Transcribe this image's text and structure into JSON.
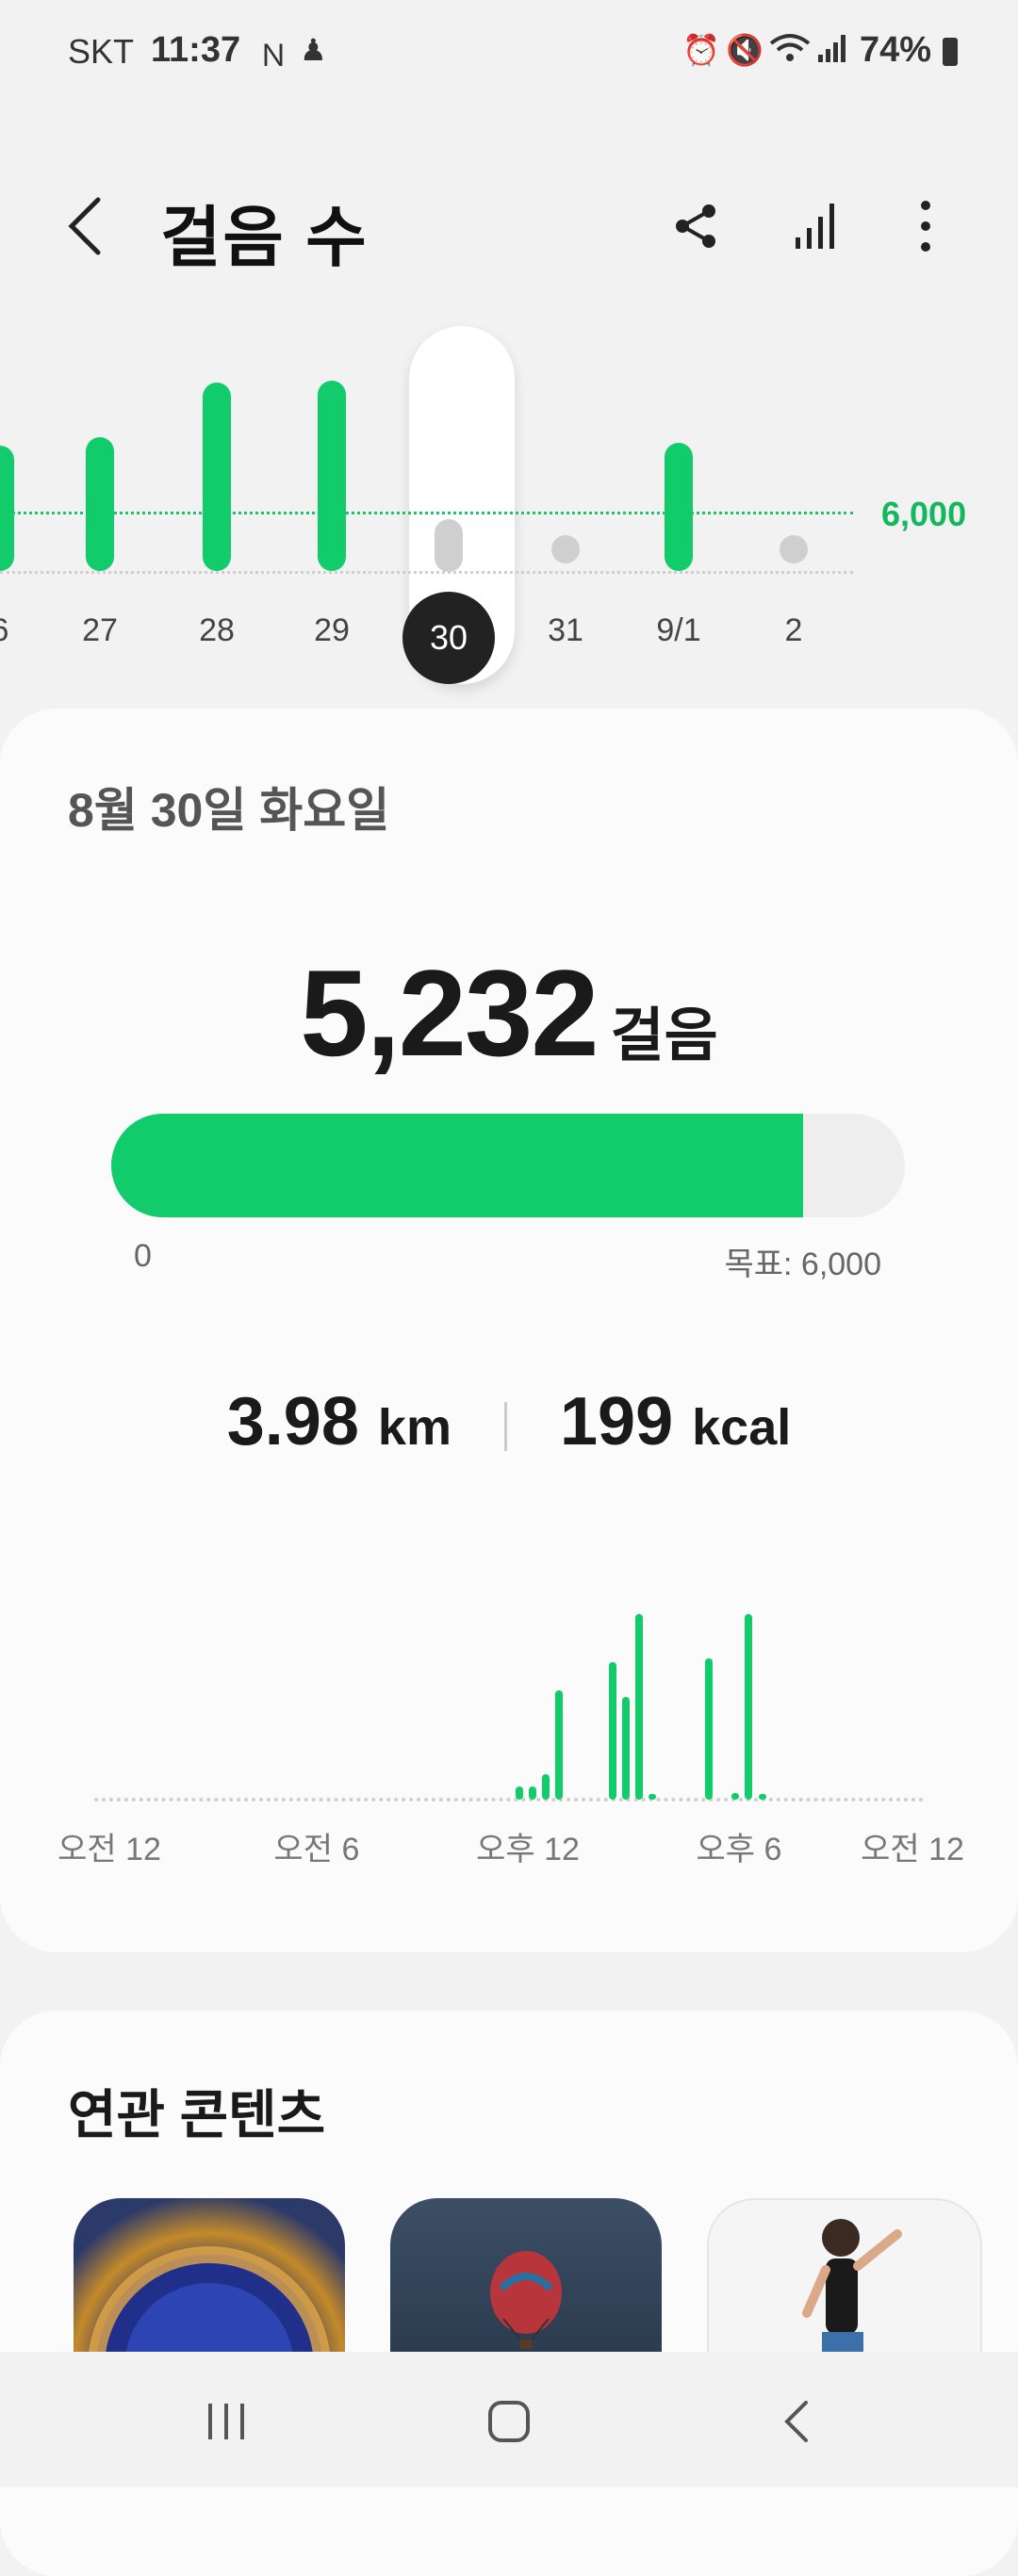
{
  "status_bar": {
    "carrier": "SKT",
    "time": "11:37",
    "battery": "74%"
  },
  "header": {
    "title": "걸음 수"
  },
  "week_chart": {
    "goal_label": "6,000",
    "days": [
      {
        "label": "6",
        "steps": 6000
      },
      {
        "label": "27",
        "steps": 6400
      },
      {
        "label": "28",
        "steps": 9000
      },
      {
        "label": "29",
        "steps": 9100
      },
      {
        "label": "30",
        "steps": 5232,
        "selected": true
      },
      {
        "label": "31",
        "steps": 0
      },
      {
        "label": "9/1",
        "steps": 6100
      },
      {
        "label": "2",
        "steps": 0
      }
    ]
  },
  "summary": {
    "date": "8월 30일 화요일",
    "steps": "5,232",
    "steps_unit": "걸음",
    "progress_fraction": 0.872,
    "progress_min": "0",
    "progress_goal": "목표: 6,000",
    "distance": "3.98",
    "distance_unit": "km",
    "calories": "199",
    "calories_unit": "kcal"
  },
  "chart_data": {
    "type": "bar",
    "x_labels": [
      "오전 12",
      "오전 6",
      "오후 12",
      "오후 6",
      "오전 12"
    ],
    "series": [
      {
        "hour": 12.3,
        "value": 8
      },
      {
        "hour": 12.7,
        "value": 8
      },
      {
        "hour": 13.1,
        "value": 16
      },
      {
        "hour": 13.5,
        "value": 68
      },
      {
        "hour": 15.1,
        "value": 86
      },
      {
        "hour": 15.5,
        "value": 64
      },
      {
        "hour": 15.9,
        "value": 116
      },
      {
        "hour": 16.3,
        "value": 3
      },
      {
        "hour": 18.0,
        "value": 88
      },
      {
        "hour": 18.8,
        "value": 4
      },
      {
        "hour": 19.2,
        "value": 116
      },
      {
        "hour": 19.6,
        "value": 3
      }
    ]
  },
  "related": {
    "title": "연관 콘텐츠"
  },
  "colors": {
    "accent": "#12cc6b",
    "inactive": "#cfcfcf"
  }
}
